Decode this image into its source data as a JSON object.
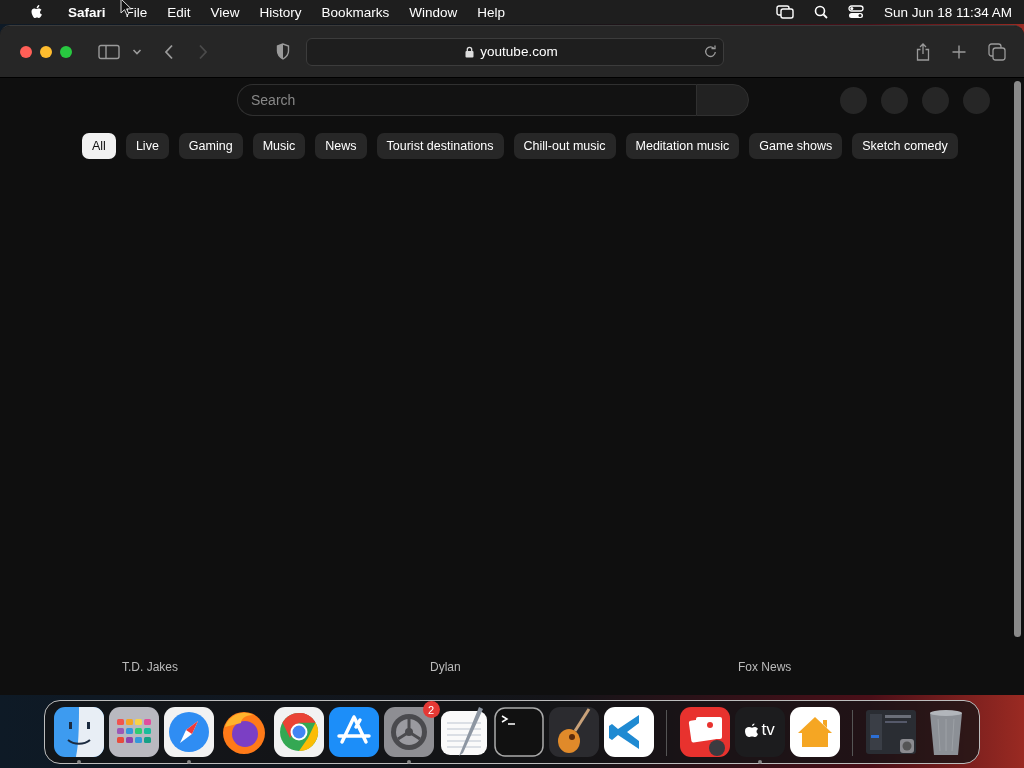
{
  "menu_bar": {
    "app": "Safari",
    "items": [
      "File",
      "Edit",
      "View",
      "History",
      "Bookmarks",
      "Window",
      "Help"
    ],
    "clock": "Sun Jun 18  11:34 AM"
  },
  "toolbar": {
    "url": "youtube.com"
  },
  "search": {
    "placeholder": "Search"
  },
  "chips": [
    {
      "label": "All",
      "selected": true
    },
    {
      "label": "Live",
      "selected": false
    },
    {
      "label": "Gaming",
      "selected": false
    },
    {
      "label": "Music",
      "selected": false
    },
    {
      "label": "News",
      "selected": false
    },
    {
      "label": "Tourist destinations",
      "selected": false
    },
    {
      "label": "Chill-out music",
      "selected": false
    },
    {
      "label": "Meditation music",
      "selected": false
    },
    {
      "label": "Game shows",
      "selected": false
    },
    {
      "label": "Sketch comedy",
      "selected": false
    }
  ],
  "channels": [
    "T.D. Jakes",
    "Dylan",
    "Fox News"
  ],
  "dock": [
    {
      "kind": "finder",
      "running": true
    },
    {
      "kind": "launchpad",
      "running": false
    },
    {
      "kind": "safari",
      "running": true
    },
    {
      "kind": "firefox",
      "running": false
    },
    {
      "kind": "chrome",
      "running": false
    },
    {
      "kind": "appstore",
      "running": false
    },
    {
      "kind": "settings",
      "running": true,
      "badge": "2"
    },
    {
      "kind": "textedit",
      "running": false
    },
    {
      "kind": "terminal",
      "running": false
    },
    {
      "kind": "guitar",
      "running": false
    },
    {
      "kind": "vscode",
      "running": false
    },
    {
      "kind": "separator"
    },
    {
      "kind": "photobooth",
      "running": false
    },
    {
      "kind": "tv",
      "running": true,
      "label": "tv"
    },
    {
      "kind": "home",
      "running": false
    },
    {
      "kind": "separator"
    },
    {
      "kind": "window",
      "running": false
    },
    {
      "kind": "trash",
      "running": false
    }
  ]
}
